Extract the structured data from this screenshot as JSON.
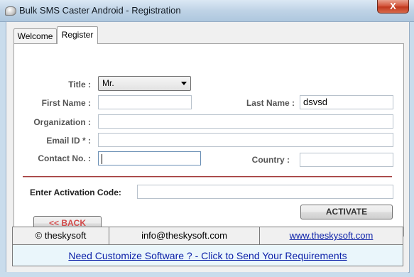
{
  "window": {
    "title": "Bulk SMS Caster Android - Registration",
    "close_symbol": "X"
  },
  "tabs": [
    {
      "label": "Welcome",
      "active": false
    },
    {
      "label": "Register",
      "active": true
    }
  ],
  "form": {
    "title_label": "Title :",
    "title_value": "Mr.",
    "first_name_label": "First Name :",
    "first_name_value": "",
    "last_name_label": "Last Name :",
    "last_name_value": "dsvsd",
    "organization_label": "Organization :",
    "organization_value": "",
    "email_label": "Email ID * :",
    "email_value": "",
    "contact_label": "Contact No. :",
    "contact_value": "",
    "country_label": "Country :",
    "country_value": "",
    "activation_label": "Enter Activation Code:",
    "activation_value": ""
  },
  "buttons": {
    "back_label": "<< BACK",
    "activate_label": "ACTIVATE"
  },
  "footer": {
    "copyright": "© theskysoft",
    "email": "info@theskysoft.com",
    "website": "www.theskysoft.com",
    "cta": "Need Customize Software ? - Click to Send Your Requirements"
  },
  "colors": {
    "back_text": "#d24b4b",
    "link_text": "#0a1fa8",
    "divider": "#a33a3a"
  }
}
